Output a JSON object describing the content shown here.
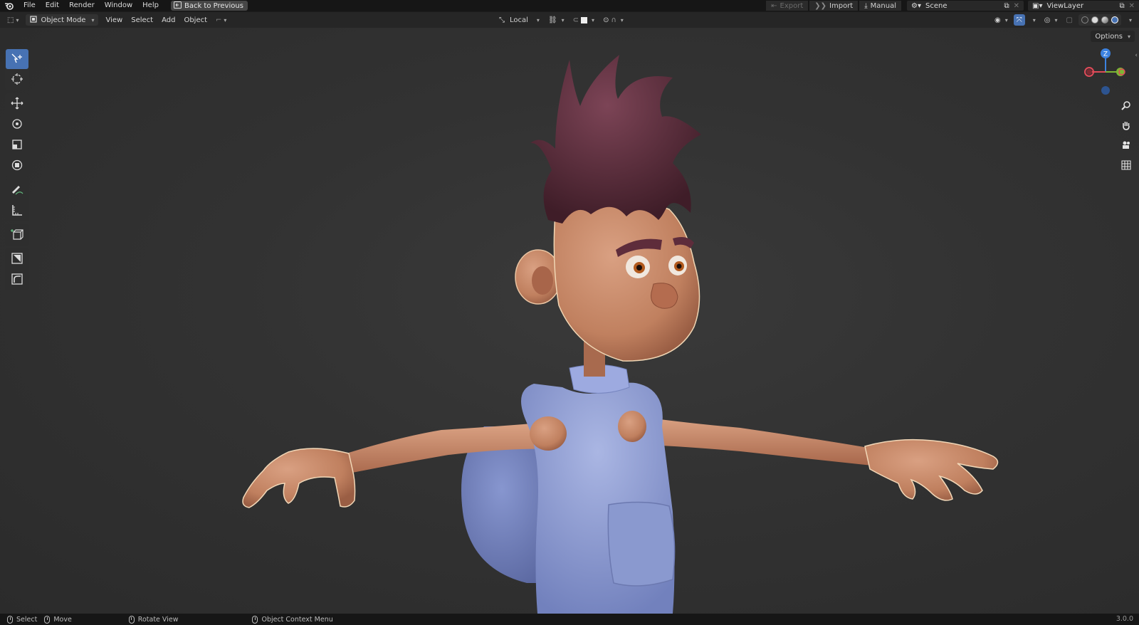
{
  "topbar": {
    "menu": [
      "File",
      "Edit",
      "Render",
      "Window",
      "Help"
    ],
    "back_label": "Back to Previous",
    "export_label": "Export",
    "import_label": "Import",
    "manual_label": "Manual",
    "scene_label": "Scene",
    "viewlayer_label": "ViewLayer"
  },
  "viewport_header": {
    "mode": "Object Mode",
    "menus": [
      "View",
      "Select",
      "Add",
      "Object"
    ],
    "orientation": "Local",
    "options_label": "Options"
  },
  "toolbar": {
    "tools": [
      "select-box-tool",
      "cursor-tool",
      "move-tool",
      "rotate-tool",
      "scale-tool",
      "transform-tool",
      "annotate-tool",
      "measure-tool",
      "add-cube-tool",
      "tool-10",
      "tool-11"
    ],
    "active_tool": "select-box-tool"
  },
  "gizmo": {
    "z_label": "Z"
  },
  "statusbar": {
    "select_label": "Select",
    "move_label": "Move",
    "rotate_label": "Rotate View",
    "context_label": "Object Context Menu",
    "version": "3.0.0"
  },
  "colors": {
    "accent": "#4772b3",
    "skin": "#c98c6c",
    "hair": "#5a2d3a",
    "shirt": "#8f9fd0",
    "viewport_bg": "#323232"
  }
}
